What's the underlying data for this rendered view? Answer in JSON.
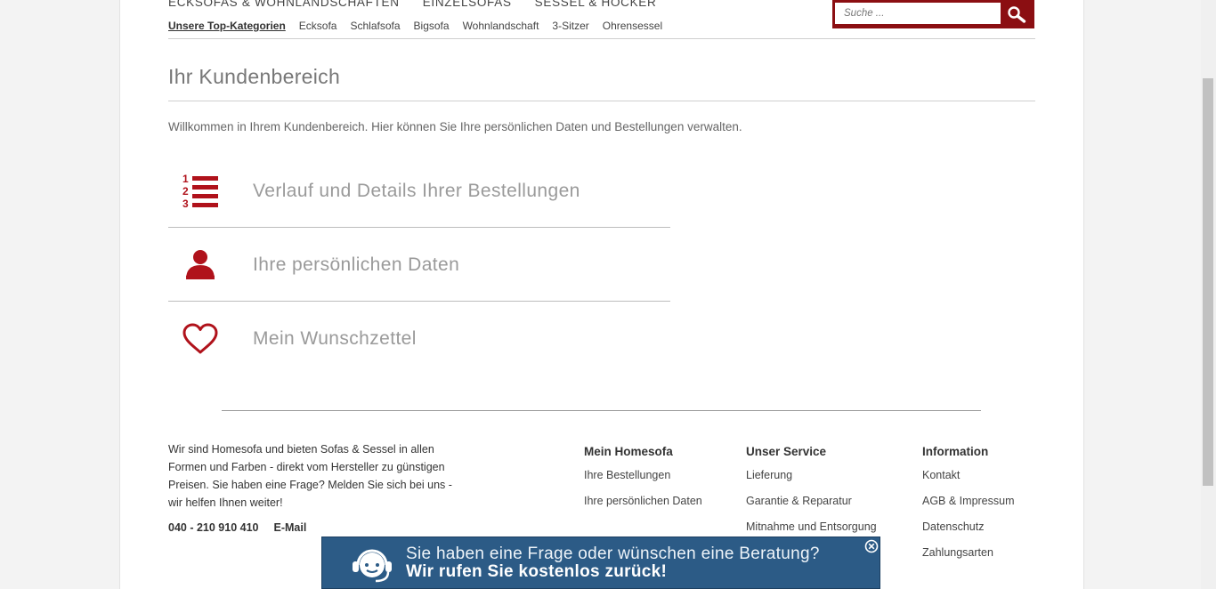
{
  "nav": {
    "main": [
      "ECKSOFAS & WOHNLANDSCHAFTEN",
      "EINZELSOFAS",
      "SESSEL & HOCKER"
    ],
    "sub": [
      "Unsere Top-Kategorien",
      "Ecksofa",
      "Schlafsofa",
      "Bigsofa",
      "Wohnlandschaft",
      "3-Sitzer",
      "Ohrensessel"
    ]
  },
  "search": {
    "placeholder": "Suche ...",
    "icon": "search-icon"
  },
  "page": {
    "title": "Ihr Kundenbereich",
    "intro": "Willkommen in Ihrem Kundenbereich. Hier können Sie Ihre persönlichen Daten und Bestellungen verwalten."
  },
  "account_menu": [
    {
      "label": "Verlauf und Details Ihrer Bestellungen",
      "icon": "numbered-list-icon"
    },
    {
      "label": "Ihre persönlichen Daten",
      "icon": "user-icon"
    },
    {
      "label": "Mein Wunschzettel",
      "icon": "heart-icon"
    }
  ],
  "accent_color": "#b0121b",
  "footer": {
    "about": "Wir sind Homesofa und bieten Sofas & Sessel in allen Formen und Farben - direkt vom Hersteller zu günstigen Preisen. Sie haben eine Frage? Melden Sie sich bei uns - wir helfen Ihnen weiter!",
    "phone": "040 - 210 910 410",
    "email": "E-Mail",
    "columns": [
      {
        "title": "Mein Homesofa",
        "links": [
          "Ihre Bestellungen",
          "Ihre persönlichen Daten"
        ]
      },
      {
        "title": "Unser Service",
        "links": [
          "Lieferung",
          "Garantie & Reparatur",
          "Mitnahme und Entsorgung"
        ]
      },
      {
        "title": "Information",
        "links": [
          "Kontakt",
          "AGB & Impressum",
          "Datenschutz",
          "Zahlungsarten"
        ]
      }
    ]
  },
  "callback_banner": {
    "line1": "Sie haben eine Frage oder wünschen eine Beratung?",
    "line2": "Wir rufen Sie kostenlos zurück!",
    "background": "#2c5b86",
    "icon": "headset-icon",
    "close_icon": "close-icon"
  }
}
